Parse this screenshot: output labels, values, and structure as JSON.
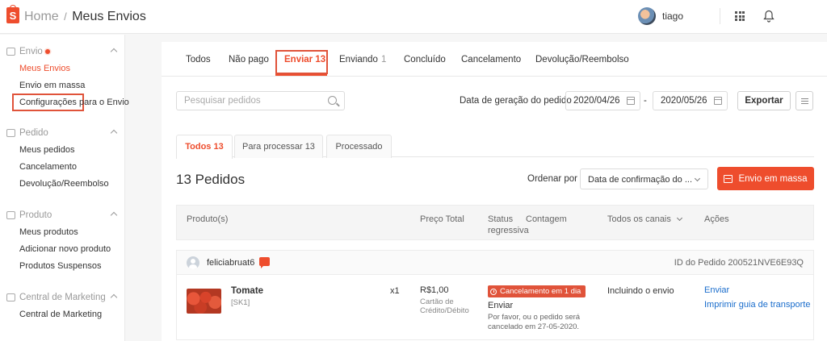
{
  "header": {
    "logo_letter": "S",
    "home": "Home",
    "separator": "/",
    "title": "Meus Envios",
    "username": "tiago",
    "icons": [
      "shopee-bag-icon",
      "avatar",
      "apps-grid-icon",
      "bell-icon"
    ]
  },
  "sidebar": {
    "sections": [
      {
        "label": "Envio",
        "icon": "truck-icon",
        "has_dot": true,
        "items": [
          "Meus Envios",
          "Envio em massa",
          "Configurações para o Envio"
        ]
      },
      {
        "label": "Pedido",
        "icon": "clipboard-icon",
        "items": [
          "Meus pedidos",
          "Cancelamento",
          "Devolução/Reembolso"
        ]
      },
      {
        "label": "Produto",
        "icon": "box-icon",
        "items": [
          "Meus produtos",
          "Adicionar novo produto",
          "Produtos Suspensos"
        ]
      },
      {
        "label": "Central de Marketing",
        "icon": "tag-icon",
        "items": [
          "Central de Marketing"
        ]
      }
    ],
    "active_item": "Meus Envios"
  },
  "tabs": {
    "todos": "Todos",
    "nao_pago": "Não pago",
    "enviar": "Enviar 13",
    "enviando": "Enviando",
    "enviando_count": "1",
    "concluido": "Concluído",
    "cancelamento": "Cancelamento",
    "devolucao": "Devolução/Reembolso",
    "active": "Enviar 13"
  },
  "filters": {
    "search_placeholder": "Pesquisar pedidos",
    "date_label": "Data de geração do pedido",
    "date_from": "2020/04/26",
    "date_sep": "-",
    "date_to": "2020/05/26",
    "export": "Exportar"
  },
  "subtabs": {
    "todos": "Todos 13",
    "processar": "Para processar 13",
    "processado": "Processado"
  },
  "orders_title": "13 Pedidos",
  "sort": {
    "label": "Ordenar por",
    "value": "Data de confirmação do ..."
  },
  "mass_button": "Envio em massa",
  "table_headers": {
    "produto": "Produto(s)",
    "preco": "Preço Total",
    "status": "Status",
    "contagem": "Contagem regressiva",
    "canais": "Todos os canais",
    "acoes": "Ações"
  },
  "order": {
    "buyer": "feliciabruat6",
    "order_id": "ID do Pedido 200521NVE6E93Q",
    "product_name": "Tomate",
    "sku": "[SK1]",
    "qty": "x1",
    "price": "R$1,00",
    "payment": "Cartão de Crédito/Débito",
    "badge": "Cancelamento em 1 dia",
    "status": "Enviar",
    "note": "Por favor, ou o pedido será cancelado em 27-05-2020.",
    "channel": "Incluindo o envio",
    "action_primary": "Enviar",
    "action_secondary": "Imprimir guia de transporte"
  },
  "colors": {
    "accent": "#ee4d2d",
    "link": "#1a6dcc"
  }
}
